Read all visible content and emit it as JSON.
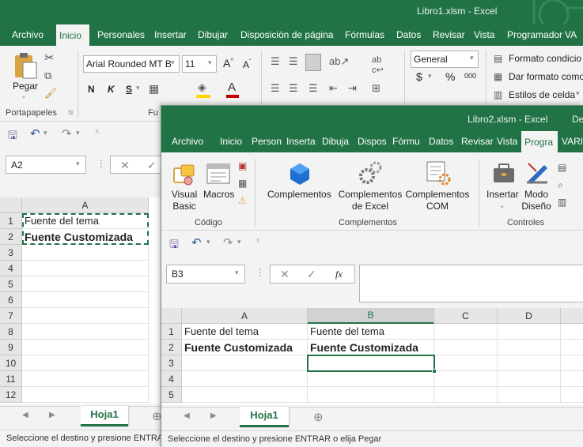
{
  "w1": {
    "title": "Libro1.xlsm  -  Excel",
    "tabs": [
      "Archivo",
      "Inicio",
      "Personales",
      "Insertar",
      "Dibujar",
      "Disposición de página",
      "Fórmulas",
      "Datos",
      "Revisar",
      "Vista",
      "Programador",
      "VA"
    ],
    "active_tab": "Inicio",
    "paste_label": "Pegar",
    "portapapeles_label": "Portapapeles",
    "fuente_label": "Fu",
    "font_name": "Arial Rounded MT B",
    "font_size": "11",
    "bold": "N",
    "italic": "K",
    "underline": "S",
    "number_format": "General",
    "currency": "$",
    "percent": "%",
    "thousands": "000",
    "cond_format": "Formato condicio",
    "table_format": "Dar formato como",
    "cell_styles": "Estilos de celda",
    "name_box": "A2",
    "col_a": "A",
    "rows": [
      "1",
      "2",
      "3",
      "4",
      "5",
      "6",
      "7",
      "8",
      "9",
      "10",
      "11",
      "12"
    ],
    "a1": "Fuente del tema",
    "a2": "Fuente Customizada",
    "sheet": "Hoja1",
    "status": "Seleccione el destino y presione ENTRAR o elija Pegar"
  },
  "w2": {
    "title": "Libro2.xlsm  -  Excel",
    "title_extra": "De",
    "tabs": [
      "Archivo",
      "Inicio",
      "Person",
      "Inserta",
      "Dibuja",
      "Dispos",
      "Fórmu",
      "Datos",
      "Revisar",
      "Vista",
      "Progra",
      "VARIA"
    ],
    "active_tab": "Progra",
    "visual_basic": [
      "Visual",
      "Basic"
    ],
    "macros": "Macros",
    "codigo_label": "Código",
    "complementos": "Complementos",
    "complementos_excel": [
      "Complementos",
      "de Excel"
    ],
    "complementos_com": [
      "Complementos",
      "COM"
    ],
    "complementos_label": "Complementos",
    "insertar": "Insertar",
    "modo_diseno": [
      "Modo",
      "Diseño"
    ],
    "controles_label": "Controles",
    "name_box": "B3",
    "fx": "fx",
    "cols": [
      "A",
      "B",
      "C",
      "D"
    ],
    "rows": [
      "1",
      "2",
      "3",
      "4",
      "5"
    ],
    "a1": "Fuente del tema",
    "b1": "Fuente del tema",
    "a2": "Fuente Customizada",
    "b2": "Fuente Customizada",
    "sheet": "Hoja1",
    "status": "Seleccione el destino y presione ENTRAR o elija Pegar"
  },
  "colors": {
    "excel_green": "#217346",
    "ribbon_bg": "#f3f3f3",
    "red": "#c00000"
  }
}
